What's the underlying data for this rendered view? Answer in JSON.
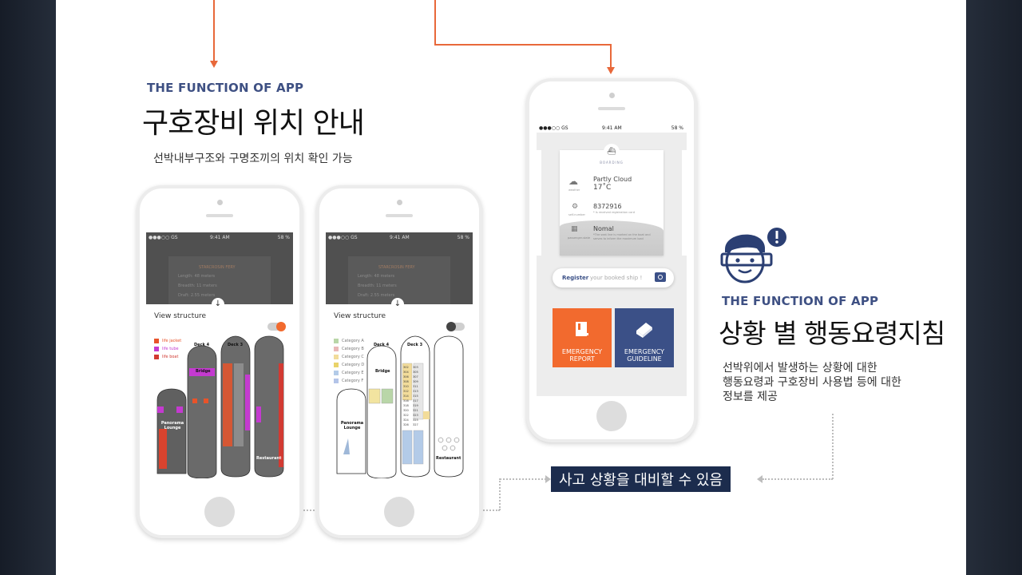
{
  "left_section": {
    "kicker": "THE FUNCTION OF APP",
    "title": "구호장비 위치 안내",
    "subtitle": "선박내부구조와 구명조끼의 위치 확인 가능"
  },
  "right_section": {
    "kicker": "THE FUNCTION OF APP",
    "title": "상황 별 행동요령지침",
    "description_lines": [
      "선박위에서 발생하는 상황에 대한",
      "행동요령과 구호장비 사용법 등에 대한",
      "정보를 제공"
    ]
  },
  "bottom_label": "사고 상황을 대비할 수 있음",
  "status_bar": {
    "carrier": "●●●○○ GS",
    "time": "9:41 AM",
    "battery": "58 %"
  },
  "phone1": {
    "ship_name": "STARCROSIN FERY",
    "specs": [
      "Length: 48 meters",
      "Breadth: 11 meters",
      "Draft: 2.55 meters"
    ],
    "view_label": "View structure",
    "legend": [
      "life jacket",
      "life tube",
      "life boat"
    ],
    "legend_colors": [
      "#e8532a",
      "#c43ad0",
      "#d23a32"
    ],
    "deck_labels": {
      "deck4": "Deck 4",
      "deck3": "Deck 3",
      "bridge": "Bridge",
      "lounge": "Panorama Lounge",
      "restaurant": "Restaurant"
    }
  },
  "phone2": {
    "ship_name": "STARCROSIN FERY",
    "specs": [
      "Length: 48 meters",
      "Breadth: 11 meters",
      "Draft: 2.55 meters"
    ],
    "view_label": "View structure",
    "legend": [
      "Category A",
      "Category B",
      "Category C",
      "Category D",
      "Category E",
      "Category F"
    ],
    "legend_colors": [
      "#b9d6a8",
      "#e9b7b7",
      "#f2dc9a",
      "#e9d36a",
      "#b3cbe8",
      "#b3c4e8"
    ],
    "deck_labels": {
      "deck4": "Deck 4",
      "deck3": "Deck 3",
      "bridge": "Bridge",
      "lounge": "Panorama Lounge",
      "restaurant": "Restaurant"
    },
    "room_numbers": [
      "302",
      "303",
      "304",
      "305",
      "306",
      "307",
      "308",
      "309",
      "310",
      "311",
      "312",
      "313",
      "314",
      "315",
      "316",
      "317",
      "318",
      "319",
      "320",
      "321",
      "322",
      "323",
      "324",
      "325",
      "326",
      "327"
    ]
  },
  "phone3": {
    "boarding_label": "BOARDING",
    "weather": {
      "caption": "weather",
      "title": "Partly Cloud",
      "value": "17˚C"
    },
    "registration": {
      "caption": "self-number",
      "number": "8372916",
      "note": "* Is received registration card"
    },
    "passenger": {
      "caption": "passenger-state",
      "status": "Nomal",
      "note": "*The seat line is marked on the boat and serves to inform the maximum load"
    },
    "register_bold": "Register",
    "register_rest": "your booked ship !",
    "tiles": [
      {
        "line1": "EMERGENCY",
        "line2": "REPORT",
        "color": "#f26a2e"
      },
      {
        "line1": "EMERGENCY",
        "line2": "GUIDELINE",
        "color": "#3b5087"
      }
    ]
  },
  "colors": {
    "accent_orange": "#e8683a",
    "navy": "#3e5083",
    "label_bg": "#1c2c4d"
  }
}
